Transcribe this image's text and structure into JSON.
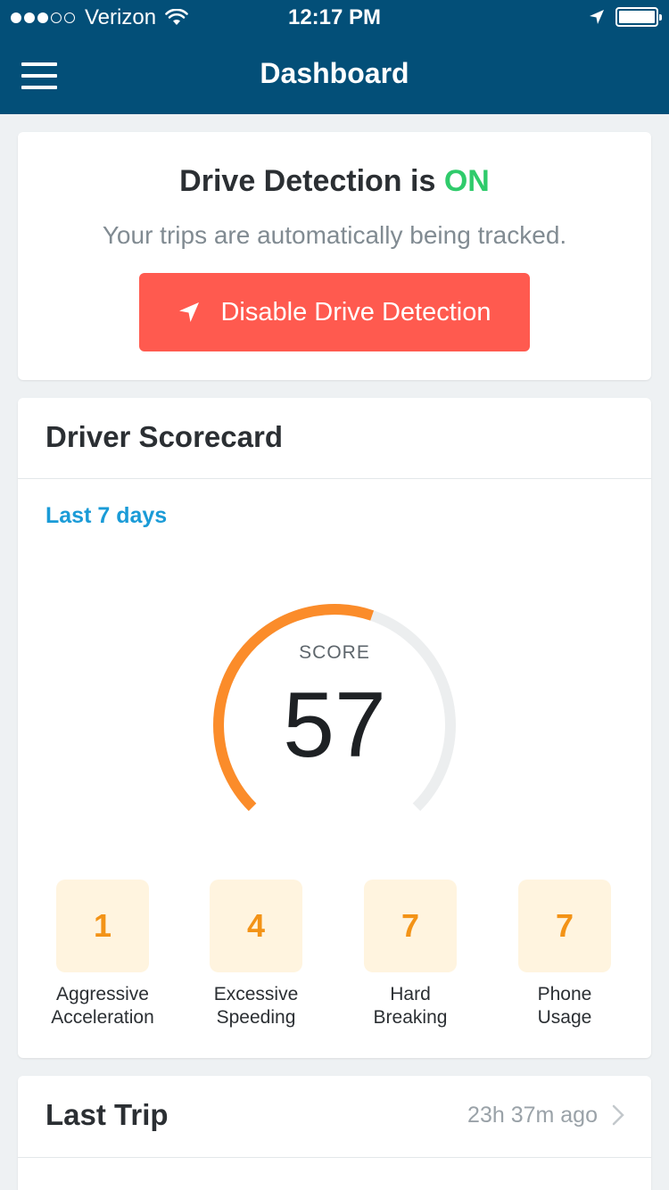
{
  "status_bar": {
    "carrier": "Verizon",
    "time": "12:17 PM",
    "signal_dots_filled": 3,
    "signal_dots_total": 5,
    "icons": [
      "wifi-icon",
      "location-arrow-icon",
      "battery-icon"
    ]
  },
  "nav": {
    "title": "Dashboard",
    "menu_icon": "hamburger-menu-icon"
  },
  "drive_detection": {
    "title_prefix": "Drive Detection is ",
    "status": "ON",
    "subtitle": "Your trips are automatically being tracked.",
    "button_label": "Disable Drive Detection",
    "button_icon": "navigation-arrow-icon"
  },
  "scorecard": {
    "title": "Driver Scorecard",
    "period": "Last 7 days",
    "score_label": "SCORE",
    "score": "57",
    "score_fraction": 0.57,
    "metrics": [
      {
        "value": "1",
        "label_line1": "Aggressive",
        "label_line2": "Acceleration"
      },
      {
        "value": "4",
        "label_line1": "Excessive",
        "label_line2": "Speeding"
      },
      {
        "value": "7",
        "label_line1": "Hard",
        "label_line2": "Breaking"
      },
      {
        "value": "7",
        "label_line1": "Phone",
        "label_line2": "Usage"
      }
    ]
  },
  "last_trip": {
    "title": "Last Trip",
    "time_ago": "23h 37m ago"
  },
  "colors": {
    "header": "#034f78",
    "on_green": "#2fcb6b",
    "disable_red": "#ff5a4f",
    "link_blue": "#1a9bd7",
    "gauge_orange": "#fb8c2a",
    "gauge_track": "#eceeef",
    "metric_bg": "#fff4df",
    "metric_text": "#f39317"
  }
}
